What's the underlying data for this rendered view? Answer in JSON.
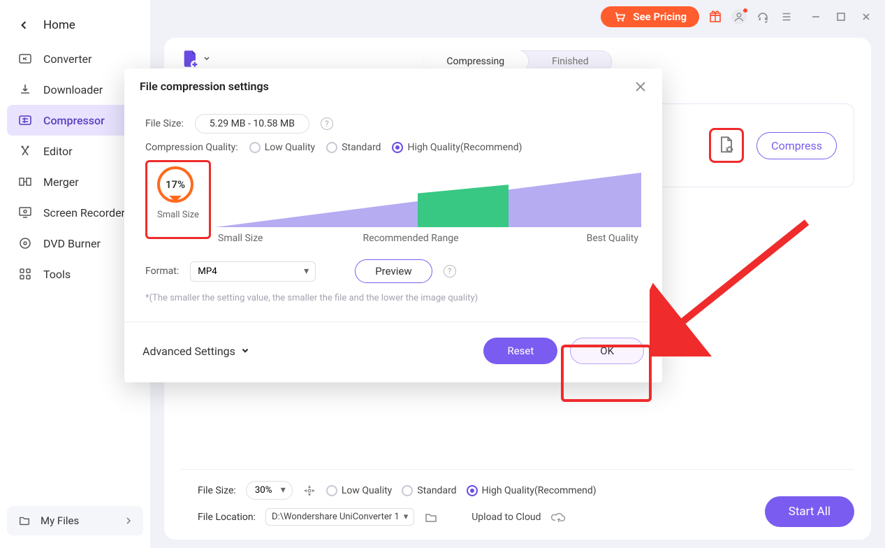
{
  "sidebar": {
    "home": "Home",
    "items": [
      {
        "label": "Converter"
      },
      {
        "label": "Downloader"
      },
      {
        "label": "Compressor"
      },
      {
        "label": "Editor"
      },
      {
        "label": "Merger"
      },
      {
        "label": "Screen Recorder"
      },
      {
        "label": "DVD Burner"
      },
      {
        "label": "Tools"
      }
    ],
    "myfiles": "My Files"
  },
  "titlebar": {
    "see_pricing": "See Pricing"
  },
  "main": {
    "tabs": {
      "compressing": "Compressing",
      "finished": "Finished"
    },
    "compress_btn": "Compress"
  },
  "footer": {
    "file_size_label": "File Size:",
    "file_size_value": "30%",
    "quality": {
      "low": "Low Quality",
      "standard": "Standard",
      "high": "High Quality(Recommend)"
    },
    "file_location_label": "File Location:",
    "file_location_value": "D:\\Wondershare UniConverter 1",
    "upload": "Upload to Cloud",
    "start_all": "Start All"
  },
  "modal": {
    "title": "File compression settings",
    "file_size_label": "File Size:",
    "file_size_value": "5.29 MB - 10.58 MB",
    "quality_label": "Compression Quality:",
    "quality": {
      "low": "Low Quality",
      "standard": "Standard",
      "high": "High Quality(Recommend)"
    },
    "percent": "17%",
    "wedge": {
      "left": "Small Size",
      "mid": "Recommended Range",
      "right": "Best Quality"
    },
    "format_label": "Format:",
    "format_value": "MP4",
    "preview": "Preview",
    "hint": "*(The smaller the setting value, the smaller the file and the lower the image quality)",
    "advanced": "Advanced Settings",
    "reset": "Reset",
    "ok": "OK"
  }
}
